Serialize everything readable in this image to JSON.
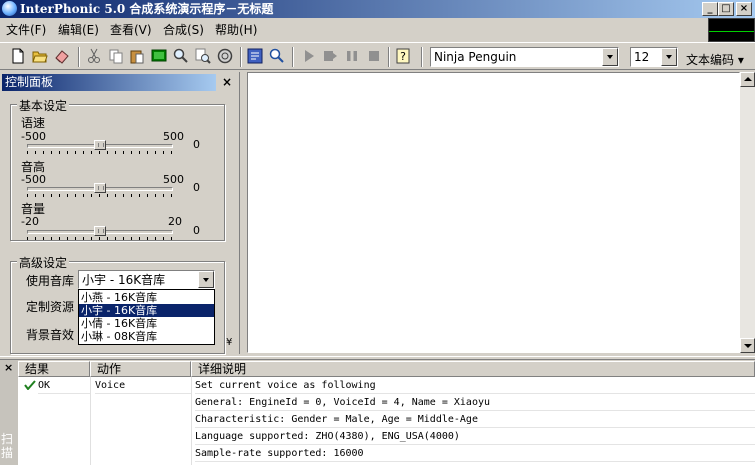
{
  "window": {
    "title": "InterPhonic 5.0 合成系统演示程序－无标题"
  },
  "menu": [
    "文件(F)",
    "编辑(E)",
    "查看(V)",
    "合成(S)",
    "帮助(H)"
  ],
  "toolbar": {
    "icons": [
      "new-file-icon",
      "open-folder-icon",
      "eraser-icon",
      "cut-icon",
      "copy-icon",
      "paste-icon",
      "screen-icon",
      "find-icon",
      "find-replace-icon",
      "globe-icon",
      "voice-settings-icon",
      "zoom-icon",
      "play-icon",
      "step-icon",
      "pause-icon",
      "stop-icon",
      "help-icon"
    ],
    "voice_name": "Ninja Penguin",
    "font_size": "12",
    "text_encoding_label": "文本编码"
  },
  "control_panel": {
    "title": "控制面板",
    "basic_group_label": "基本设定",
    "sliders": [
      {
        "label": "语速",
        "min": "-500",
        "max": "500",
        "value": "0",
        "position": 0.5
      },
      {
        "label": "音高",
        "min": "-500",
        "max": "500",
        "value": "0",
        "position": 0.5
      },
      {
        "label": "音量",
        "min": "-20",
        "max": "20",
        "value": "0",
        "position": 0.5
      }
    ],
    "advanced_group_label": "高级设定",
    "voice_lib_label": "使用音库",
    "voice_lib_value": "小宇 - 16K音库",
    "custom_resource_label": "定制资源",
    "background_label": "背景音效",
    "voice_lib_options": [
      "小燕 - 16K音库",
      "小宇 - 16K音库",
      "小倩 - 16K音库",
      "小琳 - 08K音库"
    ],
    "voice_lib_selected_index": 1
  },
  "log": {
    "side_text": "扫描",
    "columns": [
      "结果",
      "动作",
      "详细说明"
    ],
    "rows": [
      {
        "result": "OK",
        "action": "Voice",
        "detail": "Set current voice as following"
      },
      {
        "result": "",
        "action": "",
        "detail": "General: EngineId = 0, VoiceId = 4, Name = Xiaoyu"
      },
      {
        "result": "",
        "action": "",
        "detail": "Characteristic: Gender = Male, Age = Middle-Age"
      },
      {
        "result": "",
        "action": "",
        "detail": "Language supported: ZHO(4380), ENG_USA(4000)"
      },
      {
        "result": "",
        "action": "",
        "detail": "Sample-rate supported: 16000"
      }
    ]
  },
  "colors": {
    "title_active": "#0a246a",
    "title_gradient_end": "#a6caf0",
    "selection": "#0a246a",
    "face": "#d4d0c8"
  }
}
